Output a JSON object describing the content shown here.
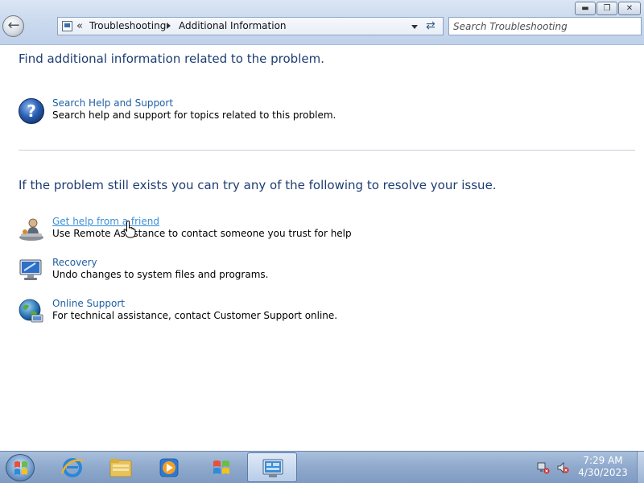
{
  "window": {
    "buttons": {
      "minimize": "minimize",
      "maximize": "maximize",
      "close": "close"
    }
  },
  "address_bar": {
    "chevron": "«",
    "breadcrumbs": [
      "Troubleshooting",
      "Additional Information"
    ]
  },
  "search": {
    "placeholder": "Search Troubleshooting"
  },
  "content": {
    "section1_heading": "Find additional information related to the problem.",
    "section2_heading": "If the problem still exists you can try any of the following to resolve your issue.",
    "tasks": [
      {
        "title": "Search Help and Support",
        "description": "Search help and support for topics related to this problem.",
        "icon": "help-question-icon"
      },
      {
        "title": "Get help from a friend",
        "description": "Use Remote Assistance to contact someone you trust for help",
        "icon": "remote-assistance-icon"
      },
      {
        "title": "Recovery",
        "description": "Undo changes to system files and programs.",
        "icon": "recovery-monitor-icon"
      },
      {
        "title": "Online Support",
        "description": "For technical assistance, contact Customer Support online.",
        "icon": "globe-support-icon"
      }
    ]
  },
  "taskbar": {
    "pinned": [
      "internet-explorer-icon",
      "file-explorer-icon",
      "media-player-icon",
      "windows-flag-icon",
      "control-panel-icon"
    ],
    "tray_icons": [
      "network-error-icon",
      "volume-muted-icon"
    ],
    "clock": {
      "time": "7:29 AM",
      "date": "4/30/2023"
    }
  }
}
